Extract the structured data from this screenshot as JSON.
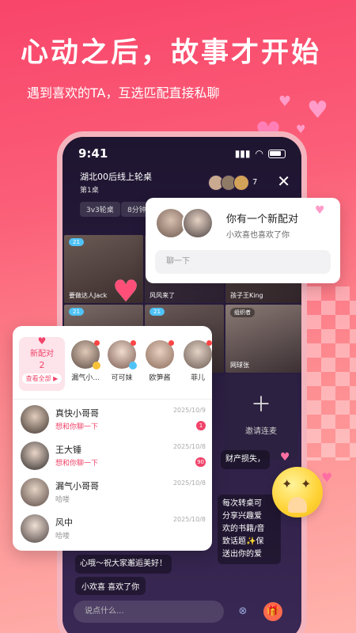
{
  "hero": {
    "headline": "心动之后，故事才开始",
    "subline": "遇到喜欢的TA，互选匹配直接私聊"
  },
  "phone": {
    "time": "9:41",
    "room_title": "湖北00后线上轮桌",
    "room_sub": "第1桌",
    "viewer_count": "7",
    "chips": [
      "3v3轮桌",
      "8分钟换"
    ],
    "cells": [
      {
        "label": "要做达人Jack",
        "badge": "21"
      },
      {
        "label": "风风来了",
        "badge": ""
      },
      {
        "label": "孩子王King",
        "badge": ""
      },
      {
        "label": "",
        "badge": "21"
      },
      {
        "label": "",
        "badge": "21"
      },
      {
        "label": "网球张",
        "badge": "组织者"
      }
    ],
    "invite": "邀请连麦",
    "chat_fragment_1": "财产损失，",
    "chat_fragment_2": "每次转桌可\n分享兴趣爱\n欢的书籍/音\n致话题✨保\n送出你的爱",
    "chat_tail": "心哦～祝大家邂逅美好！",
    "notice": "小欢喜 喜欢了你",
    "input_placeholder": "说点什么..."
  },
  "match_card": {
    "title": "你有一个新配对",
    "subtitle": "小欢喜也喜欢了你",
    "reply_placeholder": "聊一下"
  },
  "panel": {
    "new_match": {
      "label": "新配对",
      "count": "2",
      "view_all": "查看全部 ▶"
    },
    "stories": [
      {
        "name": "漏气小..."
      },
      {
        "name": "可可妹"
      },
      {
        "name": "欧笋酱"
      },
      {
        "name": "菲儿"
      }
    ],
    "conversations": [
      {
        "name": "真快小哥哥",
        "message": "想和你聊一下",
        "date": "2025/10/9",
        "unread": "1",
        "highlight": true
      },
      {
        "name": "王大锤",
        "message": "想和你聊一下",
        "date": "2025/10/8",
        "unread": "90",
        "highlight": true
      },
      {
        "name": "漏气小哥哥",
        "message": "哈喽",
        "date": "2025/10/8",
        "unread": "",
        "highlight": false
      },
      {
        "name": "风中",
        "message": "哈喽",
        "date": "2025/10/8",
        "unread": "",
        "highlight": false
      }
    ]
  },
  "colors": {
    "accent": "#f0446a",
    "bg_top": "#f8456a",
    "bg_bottom": "#ffb3ac",
    "phone_bg": "#2b1e42"
  }
}
